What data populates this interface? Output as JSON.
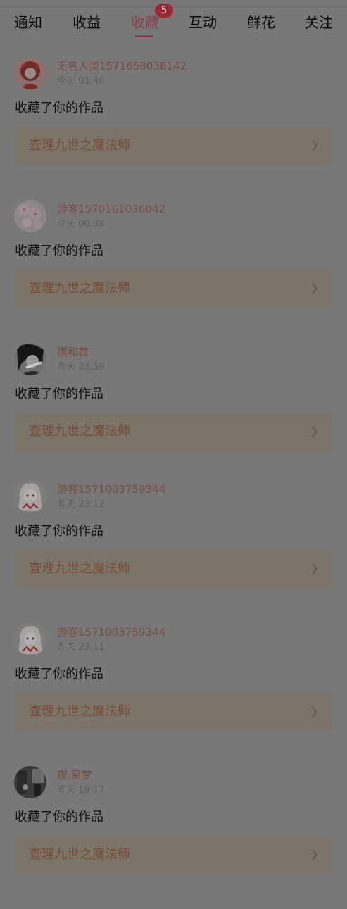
{
  "tabs": [
    {
      "label": "通知"
    },
    {
      "label": "收益"
    },
    {
      "label": "收藏",
      "badge": "5",
      "active": true
    },
    {
      "label": "互动"
    },
    {
      "label": "鲜花"
    },
    {
      "label": "关注"
    }
  ],
  "items": [
    {
      "user": "无名人类1571658038142",
      "time": "今天 01:40",
      "action": "收藏了你的作品",
      "work": "查理九世之魔法师",
      "avatar_icon": "avatar-red-hair-girl"
    },
    {
      "user": "游客1570161036042",
      "time": "今天 00:38",
      "action": "收藏了你的作品",
      "work": "查理九世之魔法师",
      "avatar_icon": "avatar-pink-flowers"
    },
    {
      "user": "雨和舞",
      "time": "昨天 23:59",
      "action": "收藏了你的作品",
      "work": "查理九世之魔法师",
      "avatar_icon": "avatar-dark-hair-character"
    },
    {
      "user": "游客1571003759344",
      "time": "昨天 23:12",
      "action": "收藏了你的作品",
      "work": "查理九世之魔法师",
      "avatar_icon": "avatar-white-hair-girl"
    },
    {
      "user": "游客1571003759344",
      "time": "昨天 23:11",
      "action": "收藏了你的作品",
      "work": "查理九世之魔法师",
      "avatar_icon": "avatar-white-hair-girl"
    },
    {
      "user": "夜.星梦",
      "time": "昨天 19:17",
      "action": "收藏了你的作品",
      "work": "查理九世之魔法师",
      "avatar_icon": "avatar-dark-photo"
    }
  ],
  "colors": {
    "overlay_background": "#787878",
    "active_tab": "#8b3f4e",
    "badge": "#9b2a35",
    "username": "#7a4b45",
    "work_title": "#7a4a37",
    "work_card": "#7b7468"
  }
}
